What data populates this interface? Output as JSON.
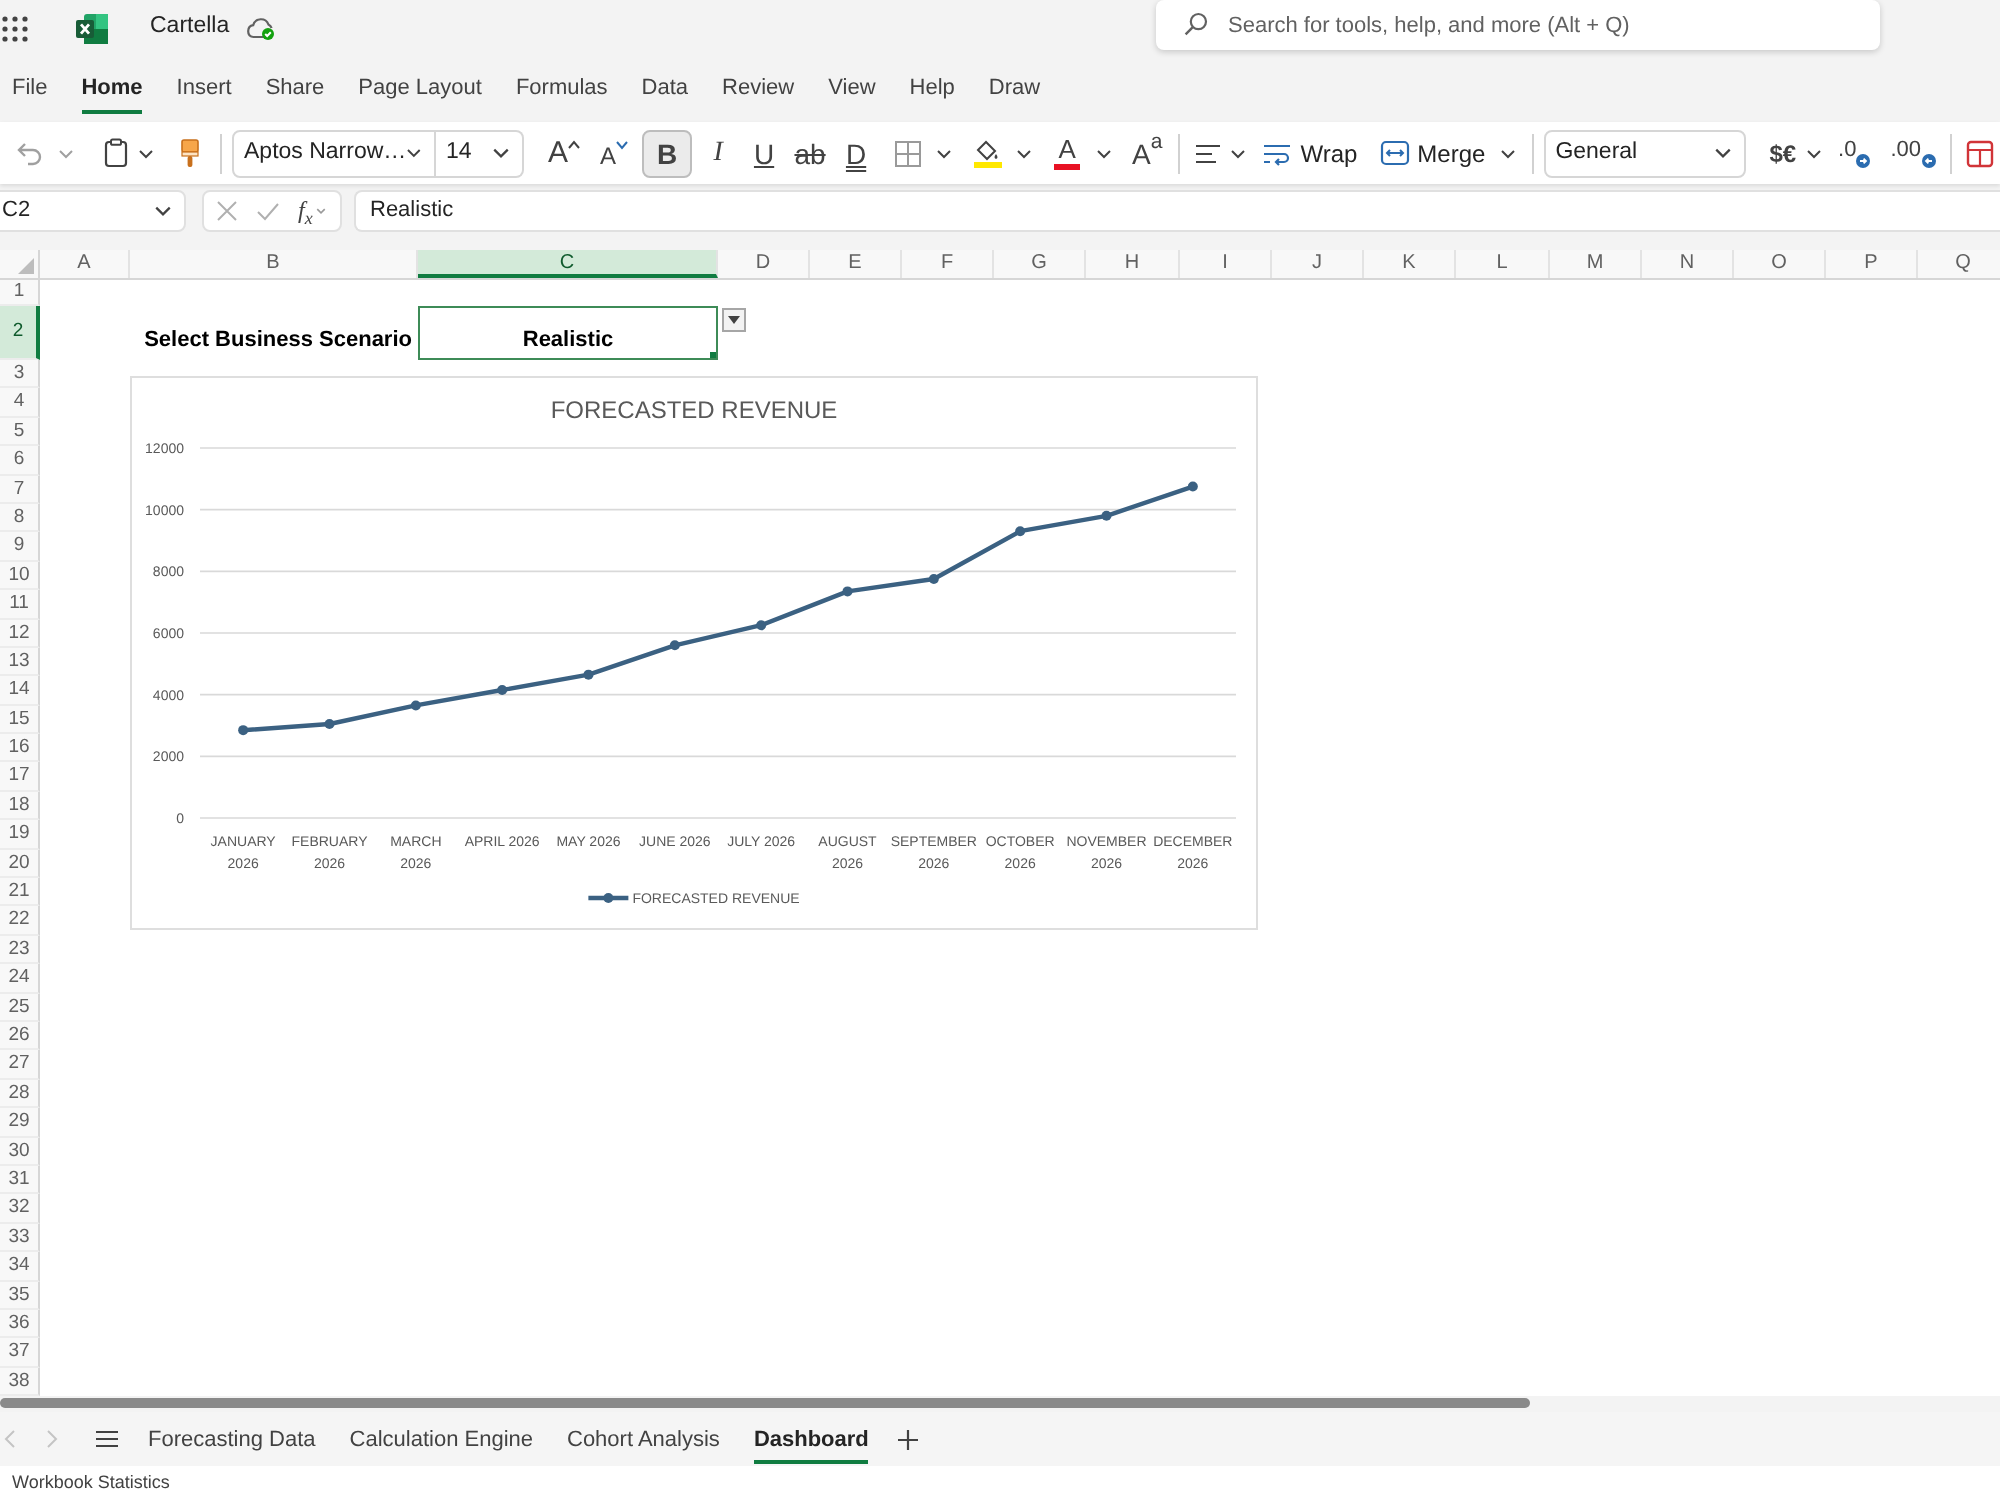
{
  "app_bar": {
    "title": "Cartella",
    "search": {
      "placeholder": "Search for tools, help, and more (Alt + Q)"
    }
  },
  "menu_tabs": [
    {
      "label": "File",
      "selected": false
    },
    {
      "label": "Home",
      "selected": true
    },
    {
      "label": "Insert",
      "selected": false
    },
    {
      "label": "Share",
      "selected": false
    },
    {
      "label": "Page Layout",
      "selected": false
    },
    {
      "label": "Formulas",
      "selected": false
    },
    {
      "label": "Data",
      "selected": false
    },
    {
      "label": "Review",
      "selected": false
    },
    {
      "label": "View",
      "selected": false
    },
    {
      "label": "Help",
      "selected": false
    },
    {
      "label": "Draw",
      "selected": false
    }
  ],
  "ribbon": {
    "font_name": "Aptos Narrow…",
    "font_size": "14",
    "grow_font": "A",
    "shrink_font": "A",
    "toggles": [
      {
        "label": "B",
        "on": true
      },
      {
        "label": "I",
        "on": false
      },
      {
        "label": "U",
        "on": false
      },
      {
        "label": "ab",
        "on": false
      },
      {
        "label": "D",
        "on": false
      }
    ],
    "font_color": "A",
    "text_styles": "A$^{a}$",
    "wrap": "Wrap",
    "merge": "Merge",
    "number_format": "General",
    "currency": "$€",
    "increase_decimal": ".0",
    "decrease_decimal": ".00"
  },
  "formula_bar": {
    "name_box": "C2",
    "function_label": "f$_{x}$",
    "formula": "Realistic"
  },
  "sheet": {
    "columns": [
      {
        "label": "A",
        "selected": false
      },
      {
        "label": "B",
        "selected": false
      },
      {
        "label": "C",
        "selected": true
      },
      {
        "label": "D",
        "selected": false
      },
      {
        "label": "E",
        "selected": false
      },
      {
        "label": "F",
        "selected": false
      },
      {
        "label": "G",
        "selected": false
      },
      {
        "label": "H",
        "selected": false
      },
      {
        "label": "I",
        "selected": false
      },
      {
        "label": "J",
        "selected": false
      },
      {
        "label": "K",
        "selected": false
      },
      {
        "label": "L",
        "selected": false
      },
      {
        "label": "M",
        "selected": false
      },
      {
        "label": "N",
        "selected": false
      },
      {
        "label": "O",
        "selected": false
      },
      {
        "label": "P",
        "selected": false
      },
      {
        "label": "Q",
        "selected": false
      }
    ],
    "rows": [
      {
        "label": "1",
        "selected": false
      },
      {
        "label": "2",
        "selected": true
      },
      {
        "label": "3",
        "selected": false
      },
      {
        "label": "4",
        "selected": false
      },
      {
        "label": "5",
        "selected": false
      },
      {
        "label": "6",
        "selected": false
      },
      {
        "label": "7",
        "selected": false
      },
      {
        "label": "8",
        "selected": false
      },
      {
        "label": "9",
        "selected": false
      },
      {
        "label": "10",
        "selected": false
      },
      {
        "label": "11",
        "selected": false
      },
      {
        "label": "12",
        "selected": false
      },
      {
        "label": "13",
        "selected": false
      },
      {
        "label": "14",
        "selected": false
      },
      {
        "label": "15",
        "selected": false
      },
      {
        "label": "16",
        "selected": false
      },
      {
        "label": "17",
        "selected": false
      },
      {
        "label": "18",
        "selected": false
      },
      {
        "label": "19",
        "selected": false
      },
      {
        "label": "20",
        "selected": false
      },
      {
        "label": "21",
        "selected": false
      },
      {
        "label": "22",
        "selected": false
      },
      {
        "label": "23",
        "selected": false
      },
      {
        "label": "24",
        "selected": false
      },
      {
        "label": "25",
        "selected": false
      },
      {
        "label": "26",
        "selected": false
      },
      {
        "label": "27",
        "selected": false
      },
      {
        "label": "28",
        "selected": false
      },
      {
        "label": "29",
        "selected": false
      },
      {
        "label": "30",
        "selected": false
      },
      {
        "label": "31",
        "selected": false
      },
      {
        "label": "32",
        "selected": false
      },
      {
        "label": "33",
        "selected": false
      },
      {
        "label": "34",
        "selected": false
      },
      {
        "label": "35",
        "selected": false
      },
      {
        "label": "36",
        "selected": false
      },
      {
        "label": "37",
        "selected": false
      },
      {
        "label": "38",
        "selected": false
      }
    ],
    "scenario_label": "Select Business Scenario",
    "scenario_cell": {
      "value": "Realistic",
      "selected": true
    },
    "chart_data": {
      "type": "line",
      "title": "FORECASTED REVENUE",
      "categories": [
        "JANUARY 2026",
        "FEBRUARY 2026",
        "MARCH 2026",
        "APRIL 2026",
        "MAY 2026",
        "JUNE 2026",
        "JULY 2026",
        "AUGUST 2026",
        "SEPTEMBER 2026",
        "OCTOBER 2026",
        "NOVEMBER 2026",
        "DECEMBER 2026"
      ],
      "series": [
        {
          "name": "FORECASTED REVENUE",
          "color": "#3b6182",
          "values": [
            2850,
            3050,
            3650,
            4150,
            4650,
            5600,
            6250,
            7350,
            7750,
            9300,
            9800,
            10750
          ]
        }
      ],
      "ylim": [
        0,
        12000
      ],
      "yticks": [
        0,
        2000,
        4000,
        6000,
        8000,
        10000,
        12000
      ],
      "grid": true,
      "marker": "circle",
      "legend": "bottom"
    }
  },
  "sheet_tabs": [
    {
      "label": "Forecasting Data",
      "selected": false
    },
    {
      "label": "Calculation Engine",
      "selected": false
    },
    {
      "label": "Cohort Analysis",
      "selected": false
    },
    {
      "label": "Dashboard",
      "selected": true
    }
  ],
  "status_bar": {
    "text": "Workbook Statistics"
  }
}
